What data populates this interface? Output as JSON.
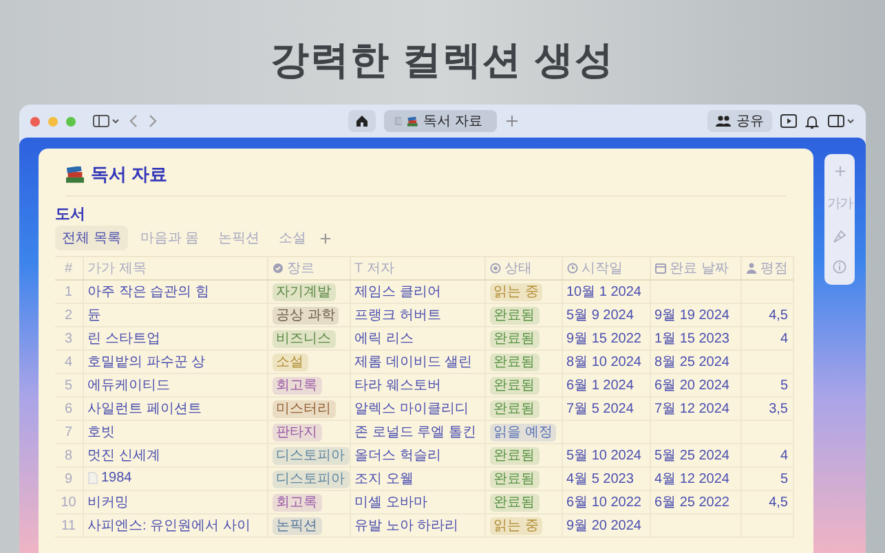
{
  "headline": "강력한 컬렉션 생성",
  "browser": {
    "tab_title": "독서 자료",
    "share_label": "공유"
  },
  "side_panel": {
    "text_size_label": "가가"
  },
  "page": {
    "title": "독서 자료"
  },
  "database": {
    "title": "도서",
    "views": [
      {
        "label": "전체 목록",
        "selected": true
      },
      {
        "label": "마음과 몸",
        "selected": false
      },
      {
        "label": "논픽션",
        "selected": false
      },
      {
        "label": "소설",
        "selected": false
      }
    ],
    "columns": [
      {
        "label": "#",
        "kind": "index"
      },
      {
        "label": "제목",
        "kind": "title",
        "glyph": "가가"
      },
      {
        "label": "장르",
        "kind": "select"
      },
      {
        "label": "저자",
        "kind": "text",
        "glyph": "T"
      },
      {
        "label": "상태",
        "kind": "status"
      },
      {
        "label": "시작일",
        "kind": "date"
      },
      {
        "label": "완료 날짜",
        "kind": "end_date"
      },
      {
        "label": "평점",
        "kind": "rating"
      }
    ],
    "rows": [
      {
        "number": "1",
        "title": "아주 작은 습관의 힘",
        "page_icon": false,
        "genre": {
          "label": "자기계발",
          "color": "#5b8a47"
        },
        "author": "제임스 클리어",
        "status": {
          "label": "읽는 중",
          "color": "#b08d35"
        },
        "start": "10월 1 2024"
      },
      {
        "number": "2",
        "title": "듄",
        "page_icon": false,
        "genre": {
          "label": "공상 과학",
          "color": "#6e5c4c"
        },
        "author": "프랭크 허버트",
        "status": {
          "label": "완료됨",
          "color": "#5a9448"
        },
        "start": "5월 9 2024",
        "end": "9월 19 2024",
        "rating": "4,5"
      },
      {
        "number": "3",
        "title": "린 스타트업",
        "page_icon": false,
        "genre": {
          "label": "비즈니스",
          "color": "#5b8a47"
        },
        "author": "에릭 리스",
        "status": {
          "label": "완료됨",
          "color": "#5a9448"
        },
        "start": "9월 15 2022",
        "end": "1월 15 2023",
        "rating": "4"
      },
      {
        "number": "4",
        "title": "호밀밭의 파수꾼 상",
        "page_icon": false,
        "genre": {
          "label": "소설",
          "color": "#b08d35"
        },
        "author": "제롬 데이비드 샐린",
        "status": {
          "label": "완료됨",
          "color": "#5a9448"
        },
        "start": "8월 10 2024",
        "end": "8월 25 2024"
      },
      {
        "number": "5",
        "title": "에듀케이티드",
        "page_icon": false,
        "genre": {
          "label": "회고록",
          "color": "#9a5aa8"
        },
        "author": "타라 웨스토버",
        "status": {
          "label": "완료됨",
          "color": "#5a9448"
        },
        "start": "6월 1 2024",
        "end": "6월 20 2024",
        "rating": "5"
      },
      {
        "number": "6",
        "title": "사일런트 페이션트",
        "page_icon": false,
        "genre": {
          "label": "미스터리",
          "color": "#946238"
        },
        "author": "알렉스 마이클리디",
        "status": {
          "label": "완료됨",
          "color": "#5a9448"
        },
        "start": "7월 5 2024",
        "end": "7월 12 2024",
        "rating": "3,5"
      },
      {
        "number": "7",
        "title": "호빗",
        "page_icon": false,
        "genre": {
          "label": "판타지",
          "color": "#9a5aa8"
        },
        "author": "존 로널드 루엘 톨킨",
        "status": {
          "label": "읽을 예정",
          "color": "#5a72b8"
        }
      },
      {
        "number": "8",
        "title": "멋진 신세계",
        "page_icon": false,
        "genre": {
          "label": "디스토피아",
          "color": "#5f86a0"
        },
        "author": "올더스 헉슬리",
        "status": {
          "label": "완료됨",
          "color": "#5a9448"
        },
        "start": "5월 10 2024",
        "end": "5월 25 2024",
        "rating": "4"
      },
      {
        "number": "9",
        "title": "1984",
        "page_icon": true,
        "genre": {
          "label": "디스토피아",
          "color": "#5f86a0"
        },
        "author": "조지 오웰",
        "status": {
          "label": "완료됨",
          "color": "#5a9448"
        },
        "start": "4월 5 2023",
        "end": "4월 12 2024",
        "rating": "5"
      },
      {
        "number": "10",
        "title": "비커밍",
        "page_icon": false,
        "genre": {
          "label": "회고록",
          "color": "#9a5aa8"
        },
        "author": "미셸 오바마",
        "status": {
          "label": "완료됨",
          "color": "#5a9448"
        },
        "start": "6월 10 2022",
        "end": "6월 25 2022",
        "rating": "4,5"
      },
      {
        "number": "11",
        "title": "사피엔스: 유인원에서 사이",
        "page_icon": false,
        "genre": {
          "label": "논픽션",
          "color": "#5a78a0"
        },
        "author": "유발 노아 하라리",
        "status": {
          "label": "읽는 중",
          "color": "#b08d35"
        },
        "start": "9월 20 2024"
      }
    ]
  }
}
